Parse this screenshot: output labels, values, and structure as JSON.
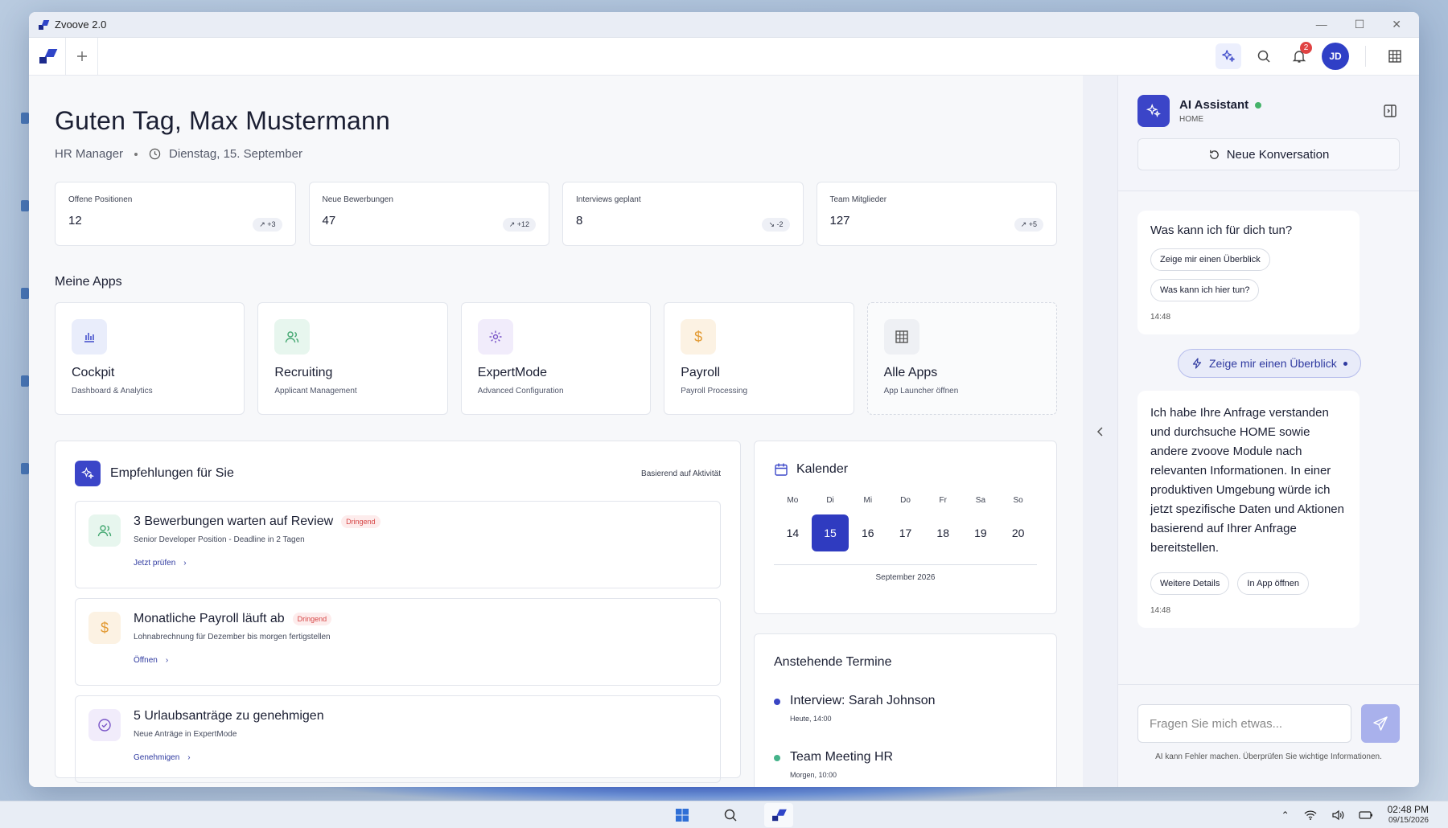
{
  "window": {
    "title": "Zvoove 2.0",
    "controls": [
      "—",
      "☐",
      "✕"
    ]
  },
  "toolbar": {
    "notifications_count": "2",
    "avatar_initials": "JD"
  },
  "header": {
    "greeting": "Guten Tag, Max Mustermann",
    "role": "HR Manager",
    "date": "Dienstag, 15. September"
  },
  "stats": [
    {
      "label": "Offene Positionen",
      "value": "12",
      "trend": "↗ +3"
    },
    {
      "label": "Neue Bewerbungen",
      "value": "47",
      "trend": "↗ +12"
    },
    {
      "label": "Interviews geplant",
      "value": "8",
      "trend": "↘ -2"
    },
    {
      "label": "Team Mitglieder",
      "value": "127",
      "trend": "↗ +5"
    }
  ],
  "apps": {
    "title": "Meine Apps",
    "items": [
      {
        "name": "Cockpit",
        "sub": "Dashboard & Analytics"
      },
      {
        "name": "Recruiting",
        "sub": "Applicant Management"
      },
      {
        "name": "ExpertMode",
        "sub": "Advanced Configuration"
      },
      {
        "name": "Payroll",
        "sub": "Payroll Processing"
      },
      {
        "name": "Alle Apps",
        "sub": "App Launcher öffnen"
      }
    ]
  },
  "recommendations": {
    "title": "Empfehlungen für Sie",
    "note": "Basierend auf Aktivität",
    "items": [
      {
        "title": "3 Bewerbungen warten auf Review",
        "tag": "Dringend",
        "sub": "Senior Developer Position - Deadline in 2 Tagen",
        "link": "Jetzt prüfen"
      },
      {
        "title": "Monatliche Payroll läuft ab",
        "tag": "Dringend",
        "sub": "Lohnabrechnung für Dezember bis morgen fertigstellen",
        "link": "Öffnen"
      },
      {
        "title": "5 Urlaubsanträge zu genehmigen",
        "sub": "Neue Anträge in ExpertMode",
        "link": "Genehmigen"
      }
    ]
  },
  "calendar": {
    "title": "Kalender",
    "weekdays": [
      "Mo",
      "Di",
      "Mi",
      "Do",
      "Fr",
      "Sa",
      "So"
    ],
    "days": [
      "14",
      "15",
      "16",
      "17",
      "18",
      "19",
      "20"
    ],
    "month": "September 2026"
  },
  "termine": {
    "title": "Anstehende Termine",
    "items": [
      {
        "title": "Interview: Sarah Johnson",
        "time": "Heute, 14:00",
        "color": "#3a45c4"
      },
      {
        "title": "Team Meeting HR",
        "time": "Morgen, 10:00",
        "color": "#45b38a"
      }
    ]
  },
  "assistant": {
    "name": "AI Assistant",
    "context": "HOME",
    "new_conversation": "Neue Konversation",
    "welcome": {
      "question": "Was kann ich für dich tun?",
      "chips": [
        "Zeige mir einen Überblick",
        "Was kann ich hier tun?"
      ],
      "time": "14:48"
    },
    "user_message": "Zeige mir einen Überblick",
    "answer": {
      "text": "Ich habe Ihre Anfrage verstanden und durchsuche HOME sowie andere zvoove Module nach relevanten Informationen. In einer produktiven Umgebung würde ich jetzt spezifische Daten und Aktionen basierend auf Ihrer Anfrage bereitstellen.",
      "chips": [
        "Weitere Details",
        "In App öffnen"
      ],
      "time": "14:48"
    },
    "input_placeholder": "Fragen Sie mich etwas...",
    "disclaimer": "AI kann Fehler machen. Überprüfen Sie wichtige Informationen."
  },
  "taskbar": {
    "time": "02:48 PM",
    "date": "09/15/2026"
  }
}
